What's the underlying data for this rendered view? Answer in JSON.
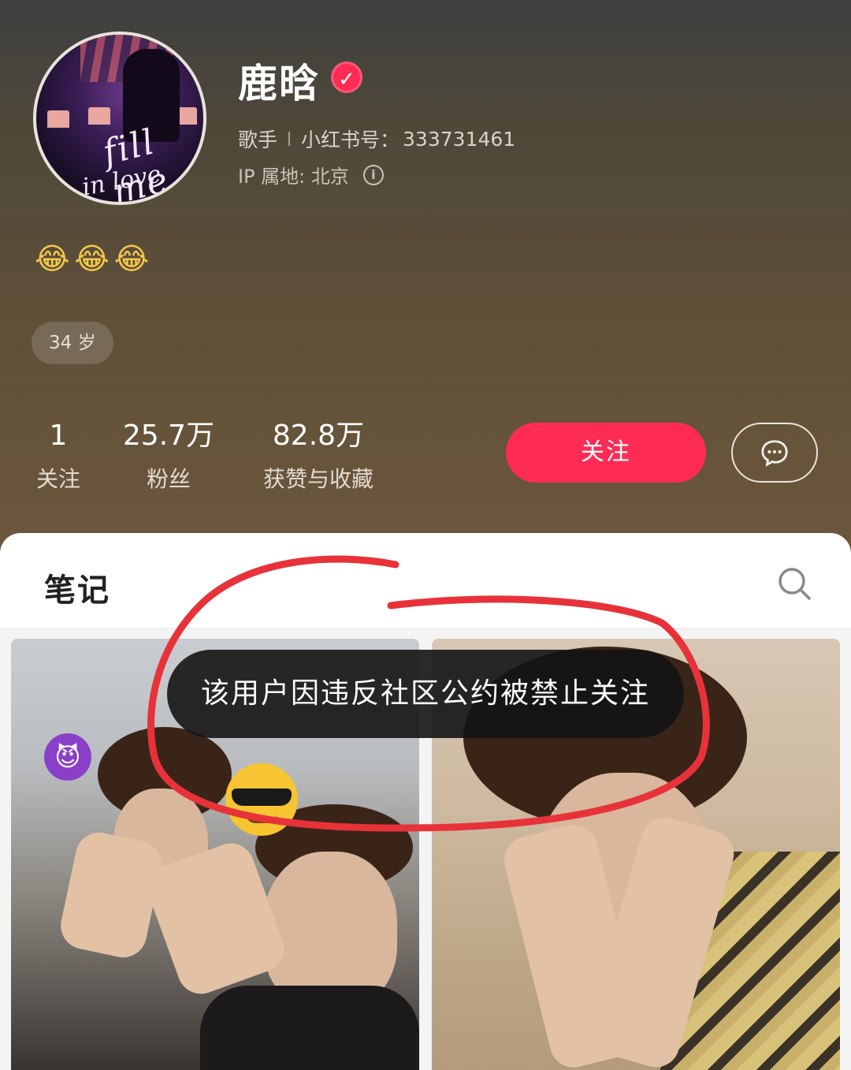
{
  "profile": {
    "name": "鹿晗",
    "verified_icon": "verified-badge-icon",
    "occupation": "歌手",
    "id_label": "小红书号：",
    "id_value": "333731461",
    "ip_label": "IP 属地: 北京",
    "bio": "😂😂😂",
    "tags": [
      "34 岁"
    ]
  },
  "stats": [
    {
      "value": "1",
      "label": "关注"
    },
    {
      "value": "25.7万",
      "label": "粉丝"
    },
    {
      "value": "82.8万",
      "label": "获赞与收藏"
    }
  ],
  "actions": {
    "follow_label": "关注",
    "message_icon": "chat-bubble-icon"
  },
  "tabs": {
    "notes_label": "笔记",
    "search_icon": "search-icon"
  },
  "toast": {
    "message": "该用户因违反社区公约被禁止关注"
  },
  "colors": {
    "accent": "#fe2c55",
    "annotation": "#e8323a"
  }
}
